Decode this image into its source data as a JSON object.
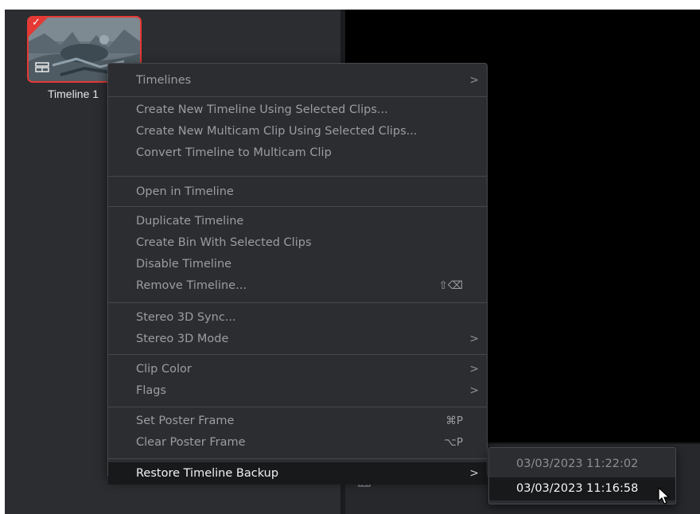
{
  "clip": {
    "name": "Timeline 1",
    "selected": true,
    "icon": "timeline-icon",
    "accent_color": "#e53935"
  },
  "viewer_bar": {
    "view_icon": "viewer-mode-icon",
    "chevron_icon": "chevron-down-icon",
    "chevron_glyph": "∨"
  },
  "context_menu": {
    "items": [
      {
        "label": "Timelines",
        "submenu": true,
        "shortcut": ""
      },
      {
        "label": "Create New Timeline Using Selected Clips...",
        "submenu": false,
        "shortcut": ""
      },
      {
        "label": "Create New Multicam Clip Using Selected Clips...",
        "submenu": false,
        "shortcut": ""
      },
      {
        "label": "Convert Timeline to Multicam Clip",
        "submenu": false,
        "shortcut": ""
      },
      {
        "label": "Open in Timeline",
        "submenu": false,
        "shortcut": ""
      },
      {
        "label": "Duplicate Timeline",
        "submenu": false,
        "shortcut": ""
      },
      {
        "label": "Create Bin With Selected Clips",
        "submenu": false,
        "shortcut": ""
      },
      {
        "label": "Disable Timeline",
        "submenu": false,
        "shortcut": ""
      },
      {
        "label": "Remove Timeline...",
        "submenu": false,
        "shortcut": "⇧⌫"
      },
      {
        "label": "Stereo 3D Sync...",
        "submenu": false,
        "shortcut": ""
      },
      {
        "label": "Stereo 3D Mode",
        "submenu": true,
        "shortcut": ""
      },
      {
        "label": "Clip Color",
        "submenu": true,
        "shortcut": ""
      },
      {
        "label": "Flags",
        "submenu": true,
        "shortcut": ""
      },
      {
        "label": "Set Poster Frame",
        "submenu": false,
        "shortcut": "⌘P"
      },
      {
        "label": "Clear Poster Frame",
        "submenu": false,
        "shortcut": "⌥P"
      },
      {
        "label": "Restore Timeline Backup",
        "submenu": true,
        "shortcut": "",
        "highlighted": true
      }
    ],
    "chevron_glyph": ">"
  },
  "backup_submenu": {
    "items": [
      {
        "label": "03/03/2023 11:22:02",
        "highlighted": false
      },
      {
        "label": "03/03/2023 11:16:58",
        "highlighted": true
      }
    ]
  },
  "colors": {
    "menu_bg": "#2c2d31",
    "menu_text": "#9b9da2",
    "highlight_bg": "#18191b",
    "highlight_text": "#f2f2f2",
    "selection_red": "#e53935"
  }
}
